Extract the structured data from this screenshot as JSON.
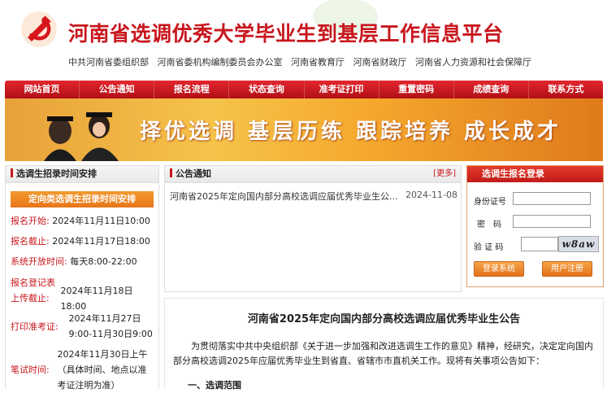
{
  "header": {
    "title": "河南省选调优秀大学毕业生到基层工作信息平台",
    "orgs": [
      "中共河南省委组织部",
      "河南省委机构编制委员会办公室",
      "河南省教育厅",
      "河南省财政厅",
      "河南省人力资源和社会保障厅"
    ]
  },
  "nav": {
    "items": [
      "网站首页",
      "公告通知",
      "报名流程",
      "状态查询",
      "准考证打印",
      "重置密码",
      "成绩查询",
      "联系方式"
    ]
  },
  "banner": {
    "slogan": "择优选调 基层历练 跟踪培养 成长成才"
  },
  "schedule": {
    "panel_title": "选调生招录时间安排",
    "tab_label": "定向类选调生招录时间安排",
    "rows": [
      {
        "label": "报名开始:",
        "value": "2024年11月11日10:00"
      },
      {
        "label": "报名截止:",
        "value": "2024年11月17日18:00"
      },
      {
        "label": "系统开放时间:",
        "value": "每天8:00-22:00"
      },
      {
        "label": "报名登记表上传截止:",
        "value": "2024年11月18日18:00"
      },
      {
        "label": "打印准考证:",
        "value": "2024年11月27日9:00-11月30日9:00"
      },
      {
        "label": "笔试时间:",
        "value": "2024年11月30日上午（具体时间、地点以准考证注明为准）"
      }
    ]
  },
  "notices": {
    "panel_title": "公告通知",
    "more_label": "[更多]",
    "items": [
      {
        "title": "河南省2025年定向国内部分高校选调应届优秀毕业生公...",
        "date": "2024-11-08"
      }
    ]
  },
  "login": {
    "title": "选调生报名登录",
    "id_label": "身份证号",
    "pwd_label": "密　码",
    "captcha_label": "验 证 码",
    "captcha_text": "w8aw",
    "login_btn": "登录系统",
    "register_btn": "用户注册"
  },
  "article": {
    "title": "河南省2025年定向国内部分高校选调应届优秀毕业生公告",
    "body": "为贯彻落实中共中央组织部《关于进一步加强和改进选调生工作的意见》精神，经研究，决定定向国内部分高校选调2025年应届优秀毕业生到省直、省辖市市直机关工作。现将有关事项公告如下：",
    "section": "一、选调范围"
  },
  "colors": {
    "brand_red": "#c8161d",
    "accent_orange": "#e7751a"
  }
}
